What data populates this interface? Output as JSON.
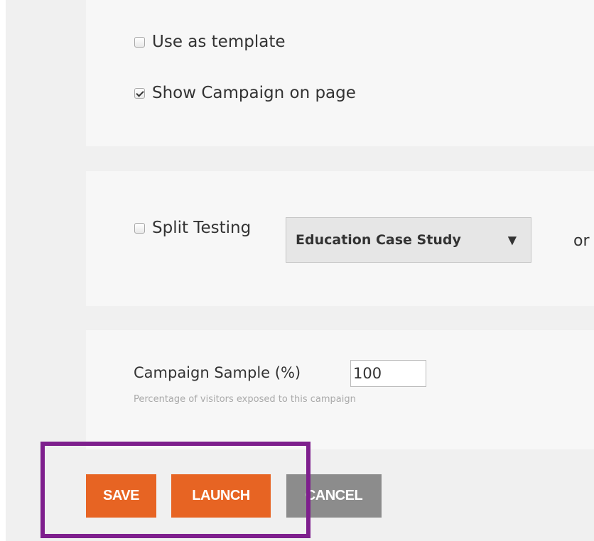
{
  "options": {
    "use_as_template": {
      "label": "Use as template",
      "checked": false
    },
    "show_campaign": {
      "label": "Show Campaign on page",
      "checked": true
    }
  },
  "split_testing": {
    "label": "Split Testing",
    "checked": false,
    "selected": "Education Case Study",
    "arrow": "▼",
    "trailing_text": "or"
  },
  "campaign_sample": {
    "label": "Campaign Sample (%)",
    "value": "100",
    "help": "Percentage of visitors exposed to this campaign"
  },
  "actions": {
    "save_label": "SAVE",
    "launch_label": "LAUNCH",
    "cancel_label": "CANCEL"
  },
  "colors": {
    "primary_button": "#e76423",
    "secondary_button": "#8c8c8c",
    "highlight_border": "#7e1f8d"
  }
}
